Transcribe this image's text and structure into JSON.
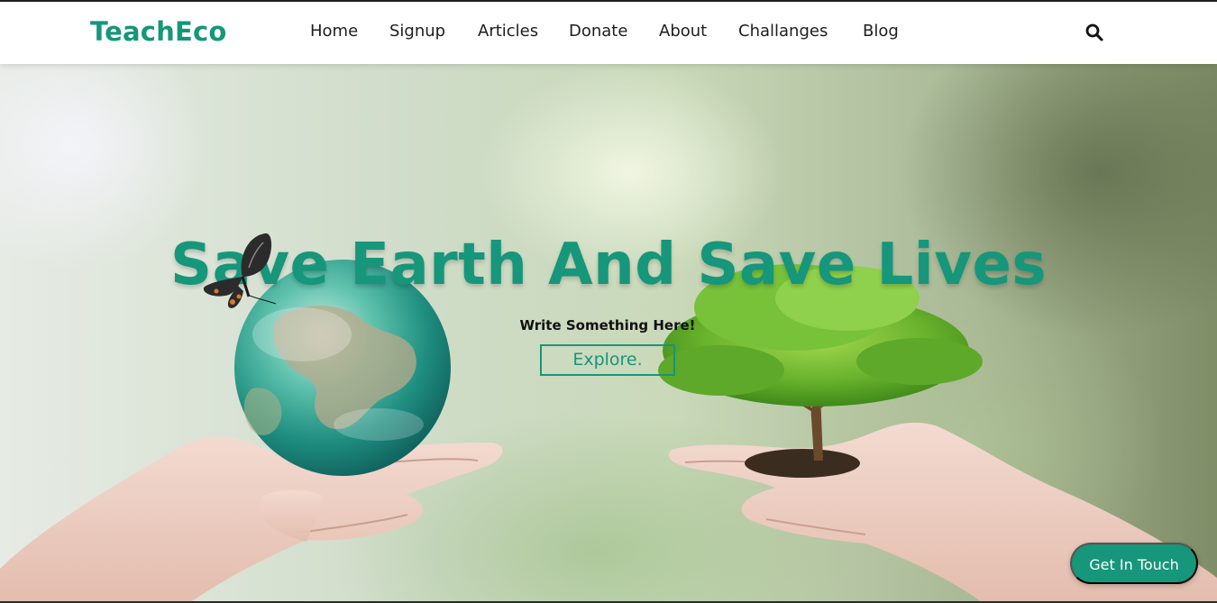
{
  "brand": {
    "name": "TeachEco",
    "accent_color": "#16967a"
  },
  "nav": {
    "items": [
      {
        "label": "Home"
      },
      {
        "label": "Signup"
      },
      {
        "label": "Articles"
      },
      {
        "label": "Donate"
      },
      {
        "label": "About"
      },
      {
        "label": "Challanges"
      },
      {
        "label": "Blog"
      }
    ],
    "search_icon": "search-icon"
  },
  "hero": {
    "title": "Save Earth And Save Lives",
    "subtitle": "Write Something Here!",
    "cta_label": "Explore.",
    "illustrations": [
      "hands-holding-globe",
      "hands-holding-tree",
      "butterfly"
    ]
  },
  "floating_button": {
    "label": "Get In Touch"
  }
}
